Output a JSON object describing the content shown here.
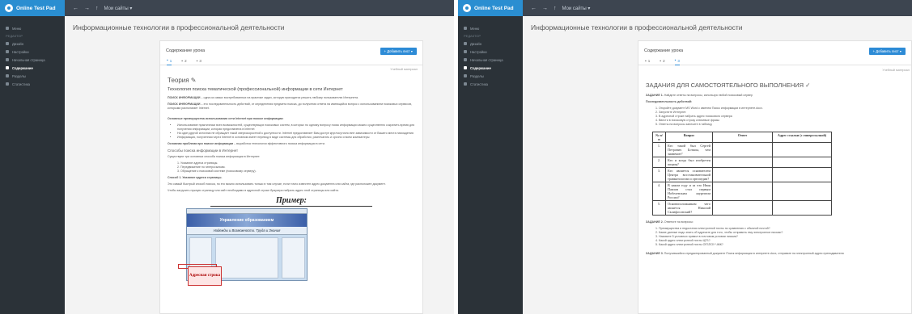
{
  "app": {
    "title": "Online Test Pad",
    "nav_back": "←",
    "nav_forward": "→",
    "nav_up": "↑",
    "nav_crumb": "Мои сайты ▾"
  },
  "sidebar": {
    "items": [
      {
        "label": "Меню",
        "section": false
      },
      {
        "label": "РЕДАКТОР",
        "section": true
      },
      {
        "label": "Дизайн",
        "section": false
      },
      {
        "label": "Настройки",
        "section": false
      },
      {
        "label": "Начальная страница",
        "section": false
      },
      {
        "label": "Содержание",
        "section": false,
        "active": true
      },
      {
        "label": "Разделы",
        "section": false
      },
      {
        "label": "Статистика",
        "section": false
      }
    ]
  },
  "page": {
    "heading": "Информационные технологии в профессиональной деятельности",
    "content_label": "Содержание урока",
    "add_button": "+ Добавить лист ▾",
    "tabs": [
      "1",
      "2",
      "3"
    ],
    "meta": "Учебный материал"
  },
  "left_doc": {
    "title": "Теория ✎",
    "subtitle": "Технология поиска тематической (профессиональной) информации в сети Интернет",
    "p1_bold": "ПОИСК ИНФОРМАЦИИ",
    "p1": " – одна из самых востребованных на практике задач, которую приходится решать любому пользователю Интернета.",
    "p2_bold": "ПОИСК ИНФОРМАЦИИ",
    "p2": " – это последовательность действий, от определения предмета поиска, до получения ответа на имеющийся вопрос с использованием поисковых сервисов, которыми располагает Internet.",
    "section1": "Основные преимущества использования сети Internet при поиске информации:",
    "bullets": [
      "Использование практически всех возможностей, существующих поисковых систем, в которых по одному вопросу поиск информации можно существенно сократить время для получения информации, которая представлена в Internet",
      "На один другой источник не обращает такой сверхскоростной к доступности. Internet предоставляет Вам доступ круглосуточно вне зависимости от Вашего места нахождения",
      "Информация, полученная через Internet в основном имеет перевод в виде системы для обработки, распечатать и срочно и всем компьютеры"
    ],
    "section2_bold": "Основная проблема при поиске информации",
    "section2": " – выработка технологии эффективного поиска информации в сети.",
    "methods_title": "Способы поиска информации в Интернет",
    "methods_intro": "Существуют три основных способа поиска информации в Интернет:",
    "methods": [
      "1. Указание адреса страницы.",
      "2. Передвижение по гиперссылкам.",
      "3. Обращение к поисковой системе (поисковому серверу)."
    ],
    "method1_title": "Способ 1. Указание адреса страницы.",
    "method1_p1": "Это самый быстрый способ поиска, но его можно использовать только в том случае, если точно известен адрес документа или сайта, где расположен документ.",
    "method1_p2": "Чтобы загрузить нужную страницу или сайт необходимо в адресной строке браузера набрать адрес этой страницы или сайта.",
    "example_label": "Пример:",
    "callout": "Адресная строка",
    "shot_title": "Управление образованием",
    "shot_subtitle": "Надежды и Возможности. Труда и Знания"
  },
  "right_doc": {
    "title": "ЗАДАНИЯ ДЛЯ САМОСТОЯТЕЛЬНОГО ВЫПОЛНЕНИЯ ✓",
    "task1_bold": "ЗАДАНИЕ 1.",
    "task1": " Найдите ответы на вопросы, используя любой поисковый сервер",
    "task1_sub": "Последовательность действий:",
    "steps": [
      "1. Откройте документ MS Word с именем Поиск информации в интернете.docx.",
      "2. Запустите Интернет.",
      "3. В адресной строке набрать адрес поискового сервера",
      "4. Ввести в поисковую строку ключевые фразы",
      "5. Ответы на вопросы занесите в таблицу"
    ],
    "table": {
      "headers": [
        "№ п/п",
        "Вопрос",
        "Ответ",
        "Адрес ссылки (с гиперссылкой)"
      ],
      "rows": [
        {
          "n": "1.",
          "q": "Кто такой был Сергей Петрович Боткин, чем знаменит?"
        },
        {
          "n": "2.",
          "q": "Кто и когда был изобретен шприц?"
        },
        {
          "n": "3.",
          "q": "Кто является основателем Центра восстановительной травматологии и ортопедии?"
        },
        {
          "n": "4.",
          "q": "В каком году и за что Иван Павлов стал первым Нобелевским лауреатом России?"
        },
        {
          "n": "5.",
          "q": "Основоположником чего является Николай Склифосовский?"
        }
      ]
    },
    "task2_bold": "ЗАДАНИЕ 2.",
    "task2": " Ответьте на вопросы:",
    "questions": [
      "1. Преимущества и недостатки электронной почты по сравнению с обычной почтой?",
      "2. Какие данные надо знать об адресате для того, чтобы отправить ему электронное письмо?",
      "3. Назовите 5 условных правил в почтовом условии письма?",
      "4. Какой адрес электронной почты ЦГБ?",
      "5. Какой адрес электронной почты ОГБПОУ ЧМК?"
    ],
    "task3_bold": "ЗАДАНИЕ 3.",
    "task3": " Получившийся отредактированный документ Поиск информации в интернете.docx, отправьте на электронный адрес преподавателя"
  }
}
